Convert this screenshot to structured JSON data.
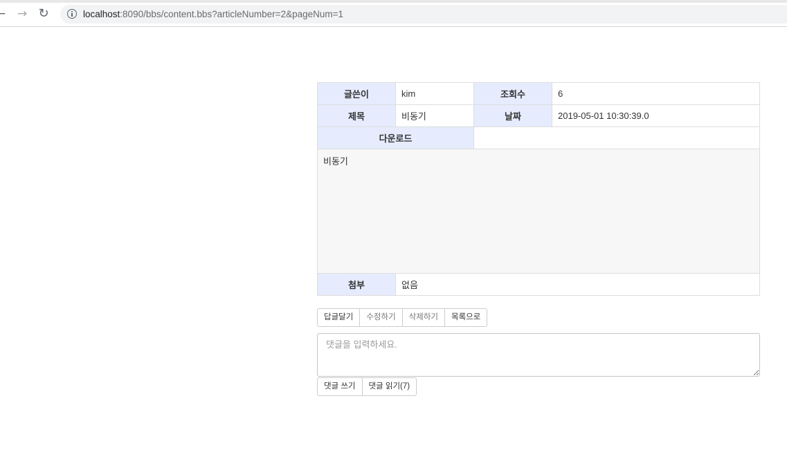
{
  "browser": {
    "url_host": "localhost",
    "url_rest": ":8090/bbs/content.bbs?articleNumber=2&pageNum=1"
  },
  "article": {
    "writer_label": "글쓴이",
    "writer": "kim",
    "hit_label": "조회수",
    "hit": "6",
    "title_label": "제목",
    "title": "비동기",
    "date_label": "날짜",
    "date": "2019-05-01 10:30:39.0",
    "download_label": "다운로드",
    "download": "",
    "content": "비동기",
    "attach_label": "첨부",
    "attach": "없음"
  },
  "actions": {
    "reply_label": "답글달기",
    "edit_label": "수정하기",
    "delete_label": "삭제하기",
    "list_label": "목록으로"
  },
  "comment": {
    "placeholder": "댓글을 입력하세요.",
    "write_label": "댓글 쓰기",
    "read_label": "댓글 읽기(7)"
  }
}
